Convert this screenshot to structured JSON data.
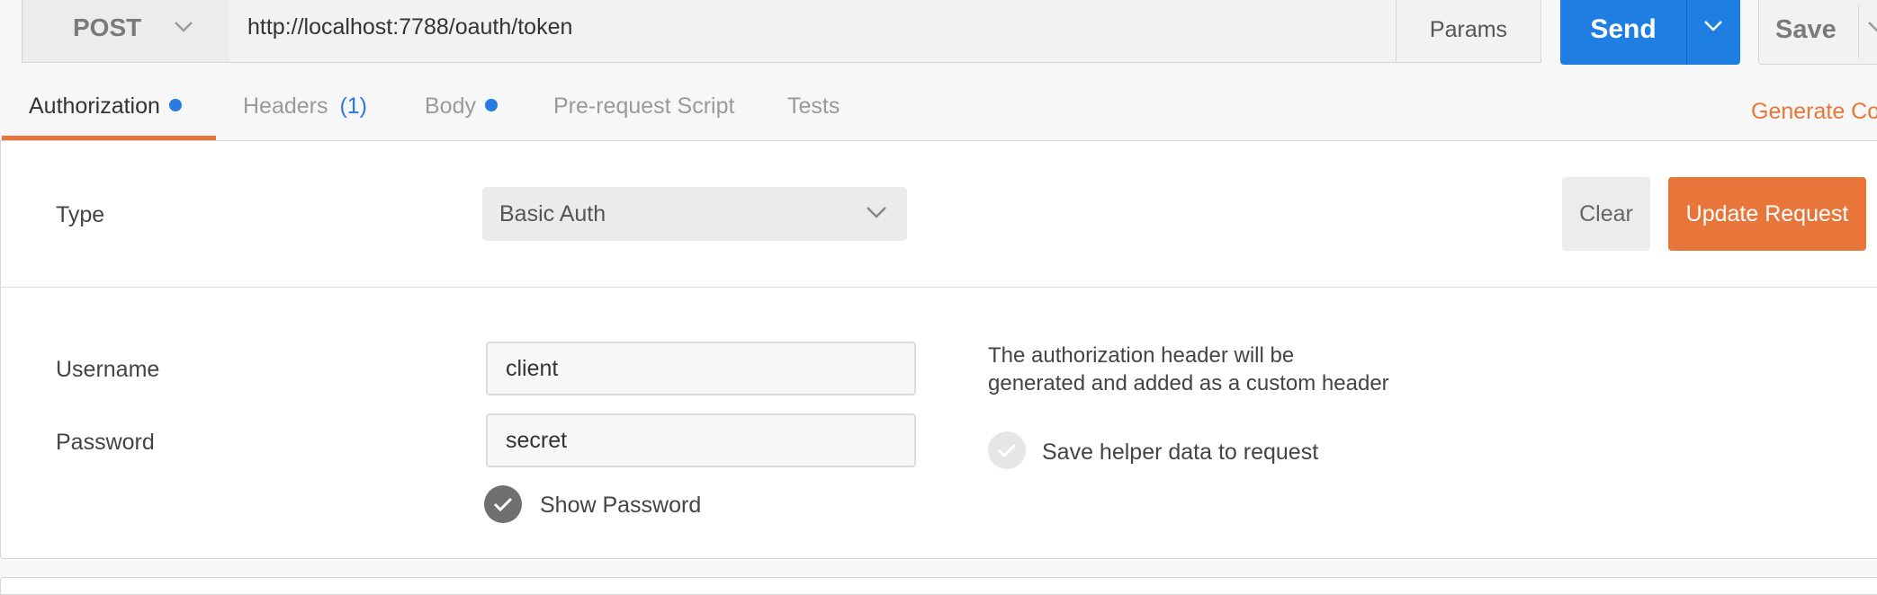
{
  "request": {
    "method": "POST",
    "url": "http://localhost:7788/oauth/token",
    "params_label": "Params",
    "send_label": "Send",
    "save_label": "Save"
  },
  "tabs": [
    {
      "label": "Authorization",
      "count": "",
      "active": true,
      "has_dot": true
    },
    {
      "label": "Headers",
      "count": "(1)",
      "active": false,
      "has_dot": false
    },
    {
      "label": "Body",
      "count": "",
      "active": false,
      "has_dot": true
    },
    {
      "label": "Pre-request Script",
      "count": "",
      "active": false,
      "has_dot": false
    },
    {
      "label": "Tests",
      "count": "",
      "active": false,
      "has_dot": false
    }
  ],
  "generate_code_label": "Generate Co",
  "auth": {
    "type_label": "Type",
    "type_value": "Basic Auth",
    "clear_label": "Clear",
    "update_label": "Update Request",
    "username_label": "Username",
    "username_value": "client",
    "password_label": "Password",
    "password_value": "secret",
    "show_password_label": "Show Password",
    "show_password_checked": true,
    "help_line1": "The authorization header will be",
    "help_line2": "generated and added as a custom header",
    "save_helper_label": "Save helper data to request",
    "save_helper_checked": false
  },
  "colors": {
    "accent_orange": "#e8763a",
    "send_blue": "#1f7ee2",
    "dot_blue": "#2a7ae2"
  }
}
